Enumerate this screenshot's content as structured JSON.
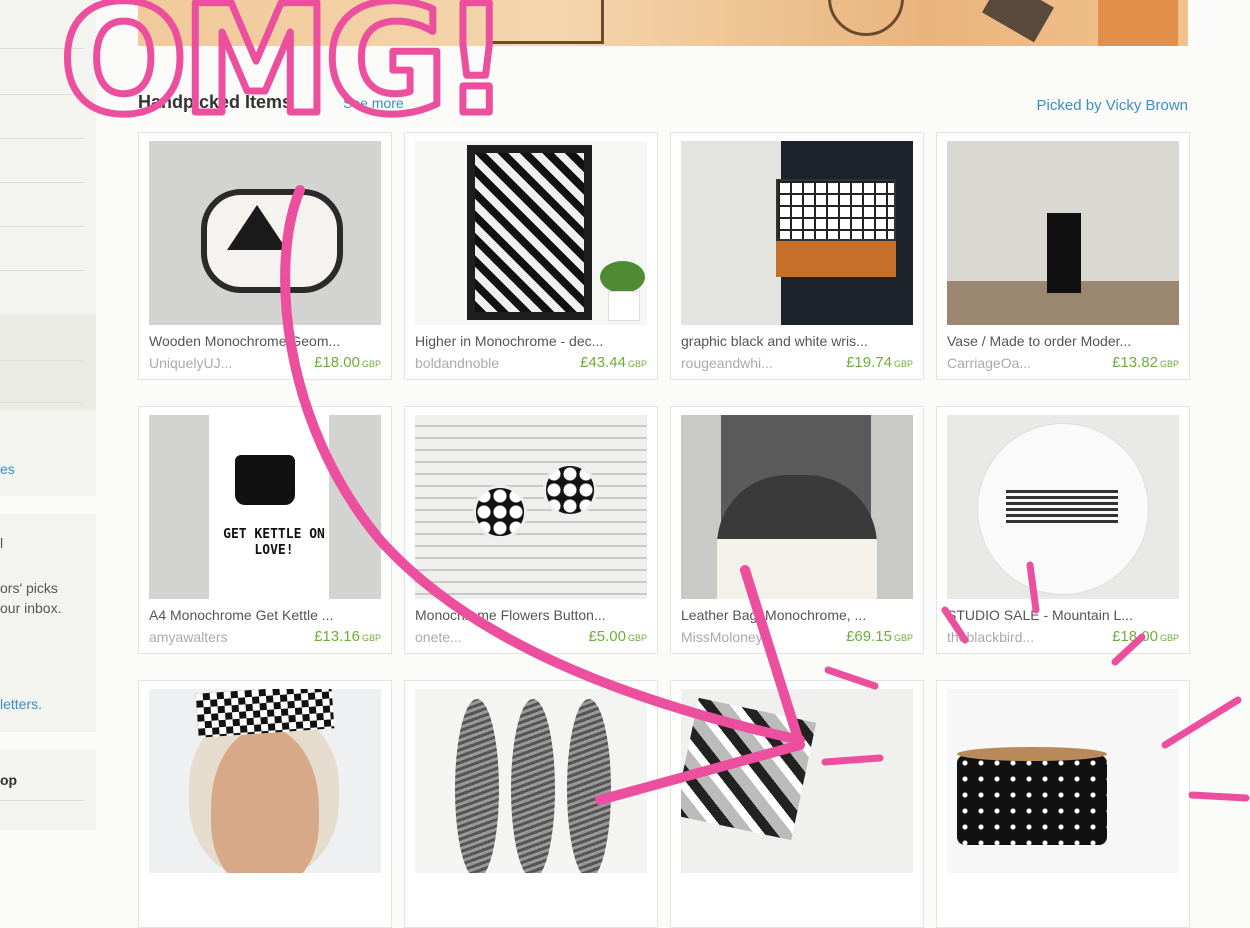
{
  "sidebar": {
    "items": [
      {
        "text": "es",
        "link": true
      },
      {
        "text": "l",
        "link": false
      },
      {
        "text": "ors' picks",
        "link": false
      },
      {
        "text": "our inbox.",
        "link": false
      },
      {
        "text": "letters.",
        "link": true
      },
      {
        "text": "op",
        "link": false
      }
    ]
  },
  "header": {
    "title": "Handpicked Items",
    "see_more": "See more",
    "picked_by": "Picked by Vicky Brown"
  },
  "items": [
    {
      "title": "Wooden Monochrome Geom...",
      "shop": "UniquelyUJ...",
      "price": "£18.00",
      "currency": "GBP"
    },
    {
      "title": "Higher in Monochrome - dec...",
      "shop": "boldandnoble",
      "price": "£43.44",
      "currency": "GBP"
    },
    {
      "title": "graphic black and white wris...",
      "shop": "rougeandwhi...",
      "price": "£19.74",
      "currency": "GBP"
    },
    {
      "title": "Vase / Made to order Moder...",
      "shop": "CarriageOa...",
      "price": "£13.82",
      "currency": "GBP"
    },
    {
      "title": "A4 Monochrome Get Kettle ...",
      "shop": "amyawalters",
      "price": "£13.16",
      "currency": "GBP",
      "poster_text": "GET KETTLE ON LOVE!"
    },
    {
      "title": "Monochrome Flowers Button...",
      "shop": "onete...",
      "price": "£5.00",
      "currency": "GBP"
    },
    {
      "title": "Leather Bag, Monochrome, ...",
      "shop": "MissMoloney",
      "price": "£69.15",
      "currency": "GBP"
    },
    {
      "title": "STUDIO SALE - Mountain L...",
      "shop": "theblackbird...",
      "price": "£18.00",
      "currency": "GBP"
    },
    {
      "title": "",
      "shop": "",
      "price": "",
      "currency": ""
    },
    {
      "title": "",
      "shop": "",
      "price": "",
      "currency": ""
    },
    {
      "title": "",
      "shop": "",
      "price": "",
      "currency": ""
    },
    {
      "title": "",
      "shop": "",
      "price": "",
      "currency": ""
    }
  ],
  "annotation": {
    "text": "OMG!",
    "color": "#ec4f9d"
  },
  "colors": {
    "link": "#3a8fc4",
    "price": "#6fae3a",
    "annotation": "#ec4f9d"
  }
}
